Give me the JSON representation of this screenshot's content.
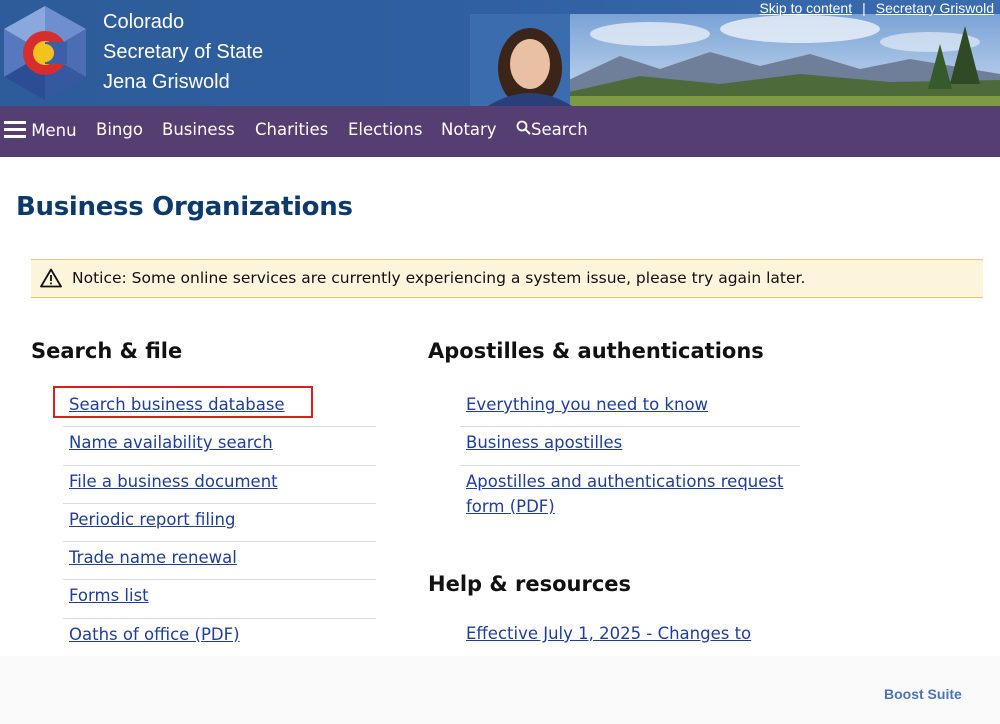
{
  "header": {
    "site_lines": [
      "Colorado",
      "Secretary of State",
      "Jena Griswold"
    ],
    "top_links": [
      "Skip to content",
      "Secretary Griswold"
    ],
    "top_links_separator": "|"
  },
  "nav": {
    "menu_label": "Menu",
    "items": [
      "Bingo",
      "Business",
      "Charities",
      "Elections",
      "Notary"
    ],
    "search_label": "Search"
  },
  "page_title": "Business Organizations",
  "notice": {
    "text": "Notice: Some online services are currently experiencing a system issue, please try again later.",
    "icon": "warning-icon"
  },
  "search_file": {
    "heading": "Search & file",
    "links": [
      "Search business database",
      "Name availability search",
      "File a business document",
      "Periodic report filing",
      "Trade name renewal",
      "Forms list",
      "Oaths of office (PDF)"
    ]
  },
  "apostilles": {
    "heading": "Apostilles & authentications",
    "links": [
      "Everything you need to know",
      "Business apostilles",
      "Apostilles and authentications request form (PDF)"
    ]
  },
  "help": {
    "heading": "Help & resources",
    "links": [
      "Effective July 1, 2025 - Changes to"
    ]
  },
  "footer_badge": "Boost Suite",
  "colors": {
    "header_blue": "#2f5fa0",
    "nav_purple": "#553f72",
    "title_navy": "#0b3a6b",
    "link_blue": "#1f3d99",
    "notice_bg": "#fdf4dc",
    "highlight_red": "#d9201f"
  }
}
